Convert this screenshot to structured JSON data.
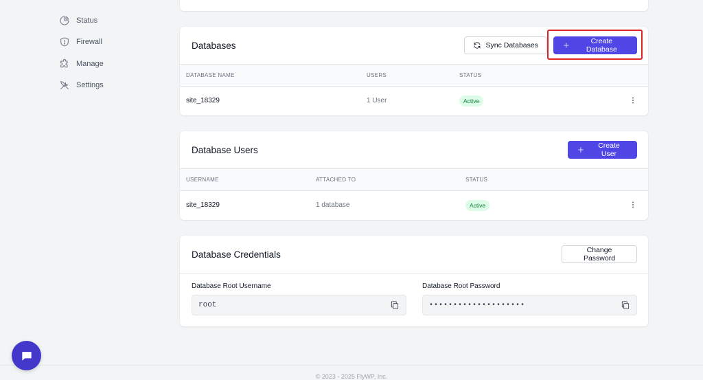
{
  "sidebar": {
    "items": [
      {
        "label": "Status",
        "icon": "pie-chart-icon"
      },
      {
        "label": "Firewall",
        "icon": "shield-icon"
      },
      {
        "label": "Manage",
        "icon": "puzzle-icon"
      },
      {
        "label": "Settings",
        "icon": "tools-icon"
      }
    ]
  },
  "databases": {
    "title": "Databases",
    "sync_label": "Sync Databases",
    "create_label": "Create Database",
    "columns": [
      "DATABASE NAME",
      "USERS",
      "STATUS"
    ],
    "rows": [
      {
        "name": "site_18329",
        "users": "1 User",
        "status": "Active"
      }
    ]
  },
  "database_users": {
    "title": "Database Users",
    "create_label": "Create User",
    "columns": [
      "USERNAME",
      "ATTACHED TO",
      "STATUS"
    ],
    "rows": [
      {
        "username": "site_18329",
        "attached_to": "1 database",
        "status": "Active"
      }
    ]
  },
  "credentials": {
    "title": "Database Credentials",
    "change_password_label": "Change Password",
    "username_label": "Database Root Username",
    "username_value": "root",
    "password_label": "Database Root Password",
    "password_value": "••••••••••••••••••••"
  },
  "footer": {
    "text": "© 2023 - 2025 FlyWP, Inc."
  },
  "colors": {
    "primary": "#4f46e5",
    "highlight": "#dc2626",
    "active_badge_bg": "#dcfce7",
    "active_badge_text": "#15803d"
  }
}
